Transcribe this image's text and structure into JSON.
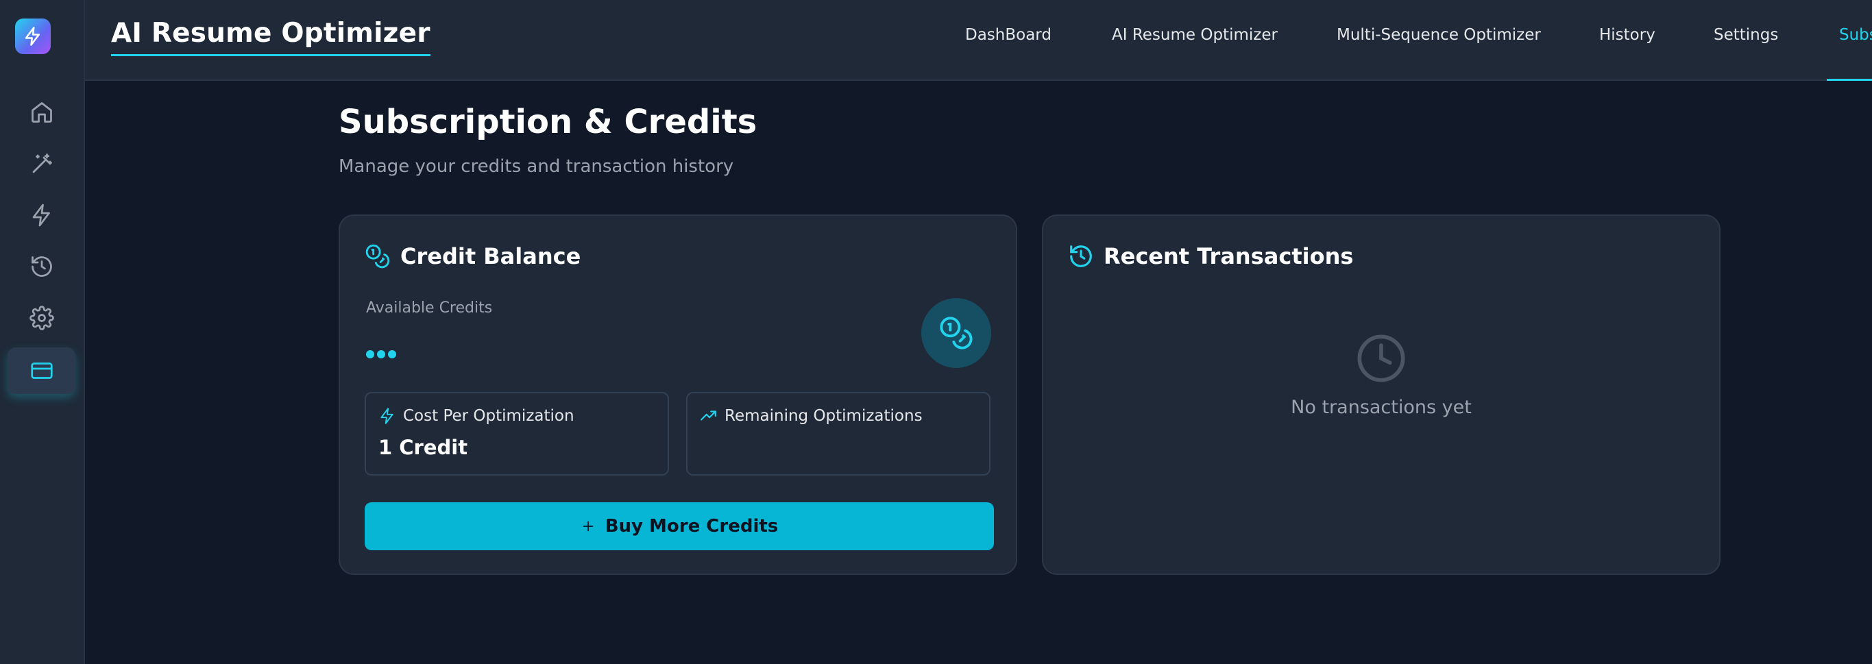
{
  "app": {
    "title": "AI Resume Optimizer",
    "accent_color": "#22d3ee",
    "logo_icon": "bolt-icon"
  },
  "nav": {
    "items": [
      {
        "label": "DashBoard"
      },
      {
        "label": "AI Resume Optimizer"
      },
      {
        "label": "Multi-Sequence Optimizer"
      },
      {
        "label": "History"
      },
      {
        "label": "Settings"
      },
      {
        "label": "Subs",
        "active": true
      }
    ]
  },
  "sidebar": {
    "items": [
      {
        "icon": "home-icon"
      },
      {
        "icon": "magic-wand-icon"
      },
      {
        "icon": "bolt-icon"
      },
      {
        "icon": "history-icon"
      },
      {
        "icon": "gear-icon"
      },
      {
        "icon": "credit-card-icon",
        "active": true
      }
    ]
  },
  "page": {
    "title": "Subscription & Credits",
    "subtitle": "Manage your credits and transaction history"
  },
  "credit_card": {
    "title": "Credit Balance",
    "title_icon": "coins-icon",
    "available_label": "Available Credits",
    "available_value_state": "loading",
    "cost": {
      "icon": "bolt-icon",
      "label": "Cost Per Optimization",
      "value": "1 Credit"
    },
    "remaining": {
      "icon": "trending-up-icon",
      "label": "Remaining Optimizations",
      "value": ""
    },
    "buy_button": {
      "icon": "plus-icon",
      "label": "Buy More Credits"
    }
  },
  "transactions_card": {
    "title": "Recent Transactions",
    "title_icon": "history-icon",
    "empty_icon": "clock-icon",
    "empty_text": "No transactions yet"
  }
}
